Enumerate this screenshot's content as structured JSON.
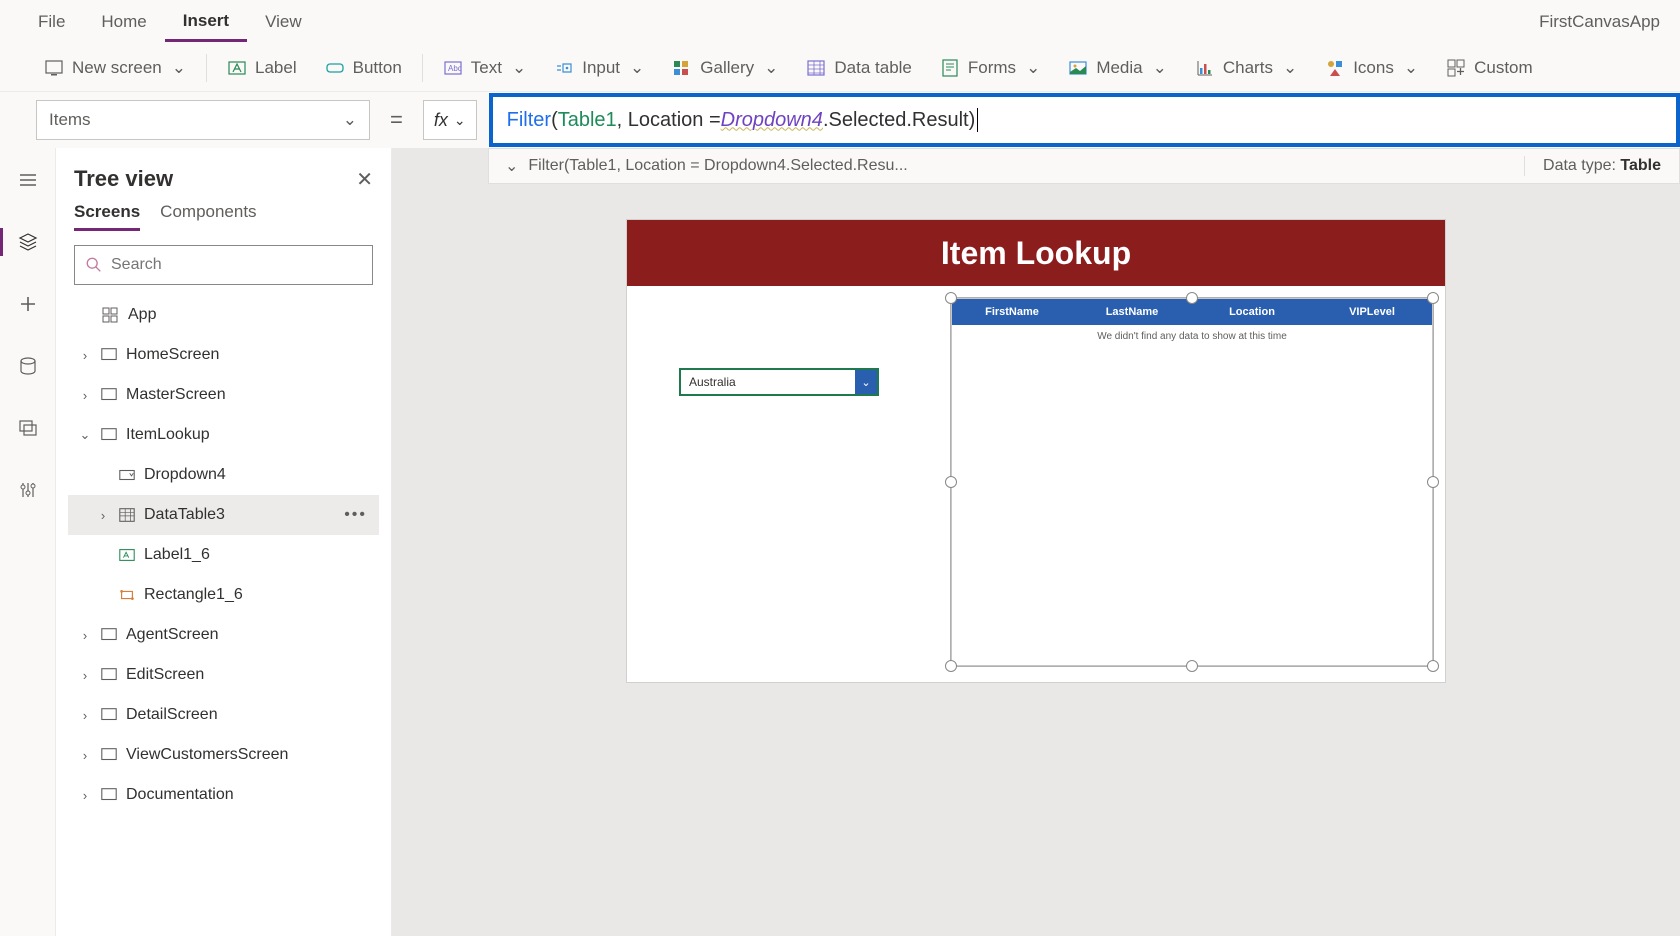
{
  "appName": "FirstCanvasApp",
  "menubar": {
    "items": [
      "File",
      "Home",
      "Insert",
      "View"
    ],
    "activeIndex": 2
  },
  "ribbon": {
    "newScreen": "New screen",
    "label": "Label",
    "button": "Button",
    "text": "Text",
    "input": "Input",
    "gallery": "Gallery",
    "dataTable": "Data table",
    "forms": "Forms",
    "media": "Media",
    "charts": "Charts",
    "icons": "Icons",
    "custom": "Custom"
  },
  "property": {
    "name": "Items"
  },
  "formula": {
    "fn": "Filter",
    "open": "(",
    "tbl": "Table1",
    "sep": ", Location = ",
    "dd": "Dropdown4",
    "rest": ".Selected.Result",
    "close": ")",
    "hint": "Filter(Table1, Location = Dropdown4.Selected.Resu...",
    "dataTypeLabel": "Data type: ",
    "dataType": "Table"
  },
  "treePanel": {
    "title": "Tree view",
    "tabs": [
      "Screens",
      "Components"
    ],
    "activeTab": 0,
    "searchPlaceholder": "Search",
    "appLabel": "App",
    "nodes": [
      {
        "label": "HomeScreen",
        "indent": 0,
        "caret": ">",
        "icon": "screen"
      },
      {
        "label": "MasterScreen",
        "indent": 0,
        "caret": ">",
        "icon": "screen"
      },
      {
        "label": "ItemLookup",
        "indent": 0,
        "caret": "v",
        "icon": "screen"
      },
      {
        "label": "Dropdown4",
        "indent": 1,
        "caret": "",
        "icon": "dropdown"
      },
      {
        "label": "DataTable3",
        "indent": 1,
        "caret": ">",
        "icon": "datatable",
        "selected": true,
        "more": true
      },
      {
        "label": "Label1_6",
        "indent": 1,
        "caret": "",
        "icon": "label"
      },
      {
        "label": "Rectangle1_6",
        "indent": 1,
        "caret": "",
        "icon": "rect"
      },
      {
        "label": "AgentScreen",
        "indent": 0,
        "caret": ">",
        "icon": "screen"
      },
      {
        "label": "EditScreen",
        "indent": 0,
        "caret": ">",
        "icon": "screen"
      },
      {
        "label": "DetailScreen",
        "indent": 0,
        "caret": ">",
        "icon": "screen"
      },
      {
        "label": "ViewCustomersScreen",
        "indent": 0,
        "caret": ">",
        "icon": "screen"
      },
      {
        "label": "Documentation",
        "indent": 0,
        "caret": ">",
        "icon": "screen"
      }
    ]
  },
  "canvas": {
    "title": "Item Lookup",
    "dropdownValue": "Australia",
    "columns": [
      "FirstName",
      "LastName",
      "Location",
      "VIPLevel"
    ],
    "emptyMsg": "We didn't find any data to show at this time"
  }
}
